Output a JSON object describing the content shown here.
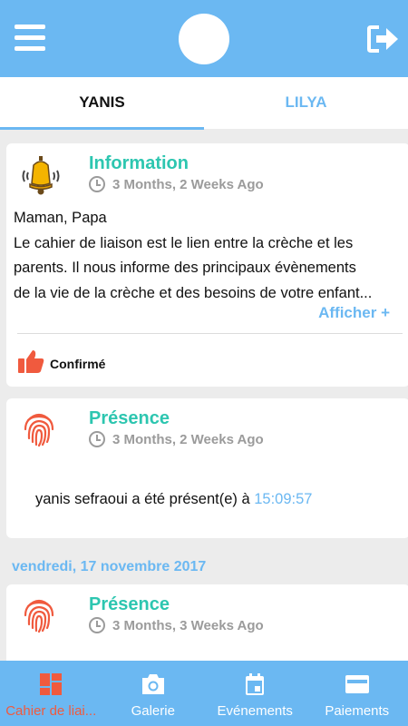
{
  "header": {
    "menu_icon": "hamburger-menu-icon",
    "logout_icon": "logout-icon"
  },
  "tabs": [
    {
      "label": "YANIS",
      "active": true
    },
    {
      "label": "LILYA",
      "active": false
    }
  ],
  "feed": {
    "cards": [
      {
        "type": "information",
        "icon": "bell-icon",
        "title": "Information",
        "time": "3 Months, 2 Weeks Ago",
        "body_lines": [
          "Maman, Papa",
          "Le cahier de liaison est le lien entre la crèche et les",
          "parents. Il nous informe des principaux évènements",
          "de la vie de la crèche et des besoins de votre enfant..."
        ],
        "show_more": "Afficher +",
        "confirm_label": "Confirmé"
      },
      {
        "type": "presence",
        "icon": "fingerprint-icon",
        "title": "Présence",
        "time": "3 Months, 2 Weeks Ago",
        "text": "yanis sefraoui a été présent(e) à ",
        "time_value": "15:09:57"
      }
    ],
    "date_header": "vendredi, 17 novembre 2017",
    "cards_after_date": [
      {
        "type": "presence",
        "icon": "fingerprint-icon",
        "title": "Présence",
        "time": "3 Months, 3 Weeks Ago"
      }
    ]
  },
  "bottom_nav": [
    {
      "label": "Cahier de liai...",
      "icon": "grid-icon",
      "active": true
    },
    {
      "label": "Galerie",
      "icon": "camera-icon",
      "active": false
    },
    {
      "label": "Evénements",
      "icon": "calendar-icon",
      "active": false
    },
    {
      "label": "Paiements",
      "icon": "credit-card-icon",
      "active": false
    }
  ],
  "colors": {
    "primary": "#6bb8f2",
    "title_teal": "#2dc6b0",
    "accent_orange": "#f05a3e",
    "muted_gray": "#9b9b9b"
  }
}
